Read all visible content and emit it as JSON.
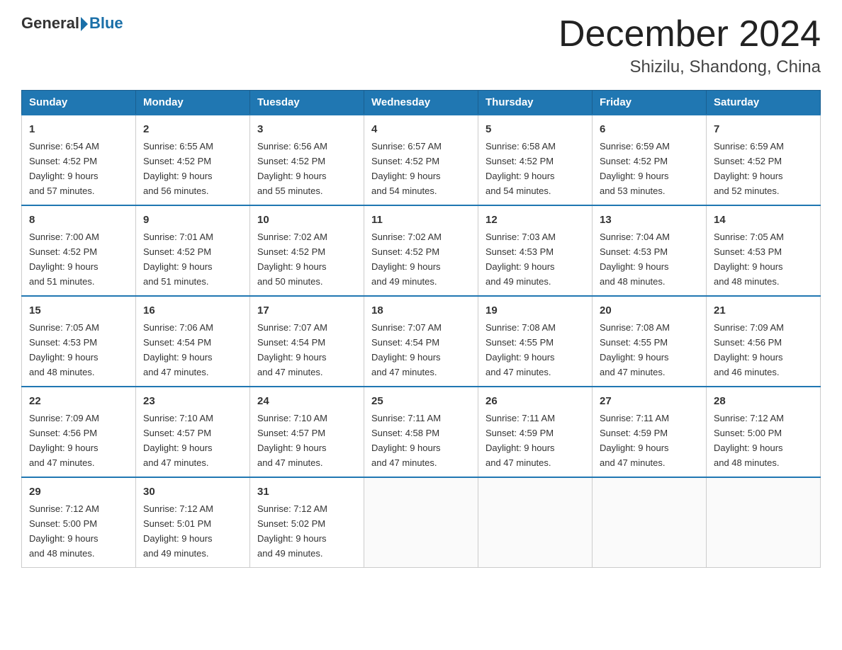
{
  "logo": {
    "text_general": "General",
    "text_blue": "Blue"
  },
  "title": "December 2024",
  "subtitle": "Shizilu, Shandong, China",
  "headers": [
    "Sunday",
    "Monday",
    "Tuesday",
    "Wednesday",
    "Thursday",
    "Friday",
    "Saturday"
  ],
  "weeks": [
    [
      {
        "day": "1",
        "sunrise": "6:54 AM",
        "sunset": "4:52 PM",
        "daylight": "9 hours and 57 minutes."
      },
      {
        "day": "2",
        "sunrise": "6:55 AM",
        "sunset": "4:52 PM",
        "daylight": "9 hours and 56 minutes."
      },
      {
        "day": "3",
        "sunrise": "6:56 AM",
        "sunset": "4:52 PM",
        "daylight": "9 hours and 55 minutes."
      },
      {
        "day": "4",
        "sunrise": "6:57 AM",
        "sunset": "4:52 PM",
        "daylight": "9 hours and 54 minutes."
      },
      {
        "day": "5",
        "sunrise": "6:58 AM",
        "sunset": "4:52 PM",
        "daylight": "9 hours and 54 minutes."
      },
      {
        "day": "6",
        "sunrise": "6:59 AM",
        "sunset": "4:52 PM",
        "daylight": "9 hours and 53 minutes."
      },
      {
        "day": "7",
        "sunrise": "6:59 AM",
        "sunset": "4:52 PM",
        "daylight": "9 hours and 52 minutes."
      }
    ],
    [
      {
        "day": "8",
        "sunrise": "7:00 AM",
        "sunset": "4:52 PM",
        "daylight": "9 hours and 51 minutes."
      },
      {
        "day": "9",
        "sunrise": "7:01 AM",
        "sunset": "4:52 PM",
        "daylight": "9 hours and 51 minutes."
      },
      {
        "day": "10",
        "sunrise": "7:02 AM",
        "sunset": "4:52 PM",
        "daylight": "9 hours and 50 minutes."
      },
      {
        "day": "11",
        "sunrise": "7:02 AM",
        "sunset": "4:52 PM",
        "daylight": "9 hours and 49 minutes."
      },
      {
        "day": "12",
        "sunrise": "7:03 AM",
        "sunset": "4:53 PM",
        "daylight": "9 hours and 49 minutes."
      },
      {
        "day": "13",
        "sunrise": "7:04 AM",
        "sunset": "4:53 PM",
        "daylight": "9 hours and 48 minutes."
      },
      {
        "day": "14",
        "sunrise": "7:05 AM",
        "sunset": "4:53 PM",
        "daylight": "9 hours and 48 minutes."
      }
    ],
    [
      {
        "day": "15",
        "sunrise": "7:05 AM",
        "sunset": "4:53 PM",
        "daylight": "9 hours and 48 minutes."
      },
      {
        "day": "16",
        "sunrise": "7:06 AM",
        "sunset": "4:54 PM",
        "daylight": "9 hours and 47 minutes."
      },
      {
        "day": "17",
        "sunrise": "7:07 AM",
        "sunset": "4:54 PM",
        "daylight": "9 hours and 47 minutes."
      },
      {
        "day": "18",
        "sunrise": "7:07 AM",
        "sunset": "4:54 PM",
        "daylight": "9 hours and 47 minutes."
      },
      {
        "day": "19",
        "sunrise": "7:08 AM",
        "sunset": "4:55 PM",
        "daylight": "9 hours and 47 minutes."
      },
      {
        "day": "20",
        "sunrise": "7:08 AM",
        "sunset": "4:55 PM",
        "daylight": "9 hours and 47 minutes."
      },
      {
        "day": "21",
        "sunrise": "7:09 AM",
        "sunset": "4:56 PM",
        "daylight": "9 hours and 46 minutes."
      }
    ],
    [
      {
        "day": "22",
        "sunrise": "7:09 AM",
        "sunset": "4:56 PM",
        "daylight": "9 hours and 47 minutes."
      },
      {
        "day": "23",
        "sunrise": "7:10 AM",
        "sunset": "4:57 PM",
        "daylight": "9 hours and 47 minutes."
      },
      {
        "day": "24",
        "sunrise": "7:10 AM",
        "sunset": "4:57 PM",
        "daylight": "9 hours and 47 minutes."
      },
      {
        "day": "25",
        "sunrise": "7:11 AM",
        "sunset": "4:58 PM",
        "daylight": "9 hours and 47 minutes."
      },
      {
        "day": "26",
        "sunrise": "7:11 AM",
        "sunset": "4:59 PM",
        "daylight": "9 hours and 47 minutes."
      },
      {
        "day": "27",
        "sunrise": "7:11 AM",
        "sunset": "4:59 PM",
        "daylight": "9 hours and 47 minutes."
      },
      {
        "day": "28",
        "sunrise": "7:12 AM",
        "sunset": "5:00 PM",
        "daylight": "9 hours and 48 minutes."
      }
    ],
    [
      {
        "day": "29",
        "sunrise": "7:12 AM",
        "sunset": "5:00 PM",
        "daylight": "9 hours and 48 minutes."
      },
      {
        "day": "30",
        "sunrise": "7:12 AM",
        "sunset": "5:01 PM",
        "daylight": "9 hours and 49 minutes."
      },
      {
        "day": "31",
        "sunrise": "7:12 AM",
        "sunset": "5:02 PM",
        "daylight": "9 hours and 49 minutes."
      },
      null,
      null,
      null,
      null
    ]
  ],
  "labels": {
    "sunrise": "Sunrise:",
    "sunset": "Sunset:",
    "daylight": "Daylight:"
  }
}
